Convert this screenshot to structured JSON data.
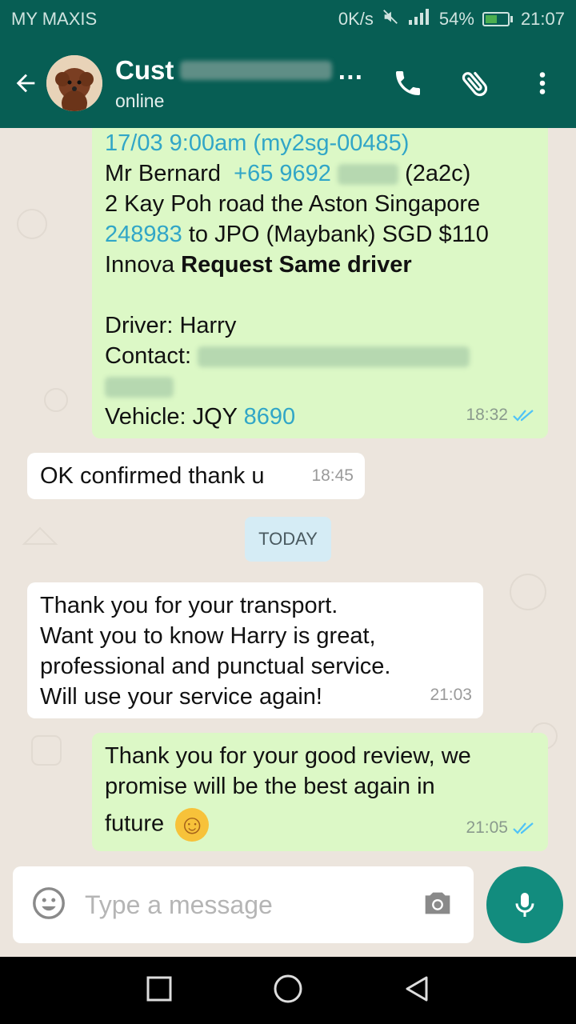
{
  "status_bar": {
    "carrier": "MY MAXIS",
    "speed": "0K/s",
    "battery": "54%",
    "time": "21:07"
  },
  "header": {
    "contact_name": "Cust",
    "status": "online",
    "icons": [
      "back-arrow-icon",
      "phone-icon",
      "attach-icon",
      "more-vert-icon"
    ]
  },
  "messages": [
    {
      "direction": "out",
      "lines": [
        "17/03  9:00am  (my2sg-00485)",
        "Mr Bernard  +65 9692",
        "(2a2c)",
        "2 Kay Poh road the Aston Singapore",
        "248983",
        " to JPO (Maybank)  SGD $110",
        "Innova  ",
        "Request Same driver",
        "Driver: Harry",
        "Contact: ",
        "Vehicle: JQY ",
        "8690"
      ],
      "time": "18:32"
    },
    {
      "direction": "in",
      "text": "OK confirmed thank u",
      "time": "18:45"
    },
    {
      "direction": "in",
      "lines": [
        "Thank you for your transport.",
        "Want you to know Harry is great,",
        "professional and punctual service.",
        "Will use your service again!"
      ],
      "time": "21:03"
    },
    {
      "direction": "out",
      "lines": [
        "Thank you for your good review, we",
        "promise will be the best again in",
        "future"
      ],
      "emoji": "☺",
      "time": "21:05"
    }
  ],
  "day_divider": "TODAY",
  "composer": {
    "placeholder": "Type a message"
  },
  "colors": {
    "header": "#075e54",
    "outgoing": "#dcf8c6",
    "incoming": "#ffffff",
    "wallpaper": "#ece5dd",
    "fab": "#128c7e",
    "tick": "#4fc3f7"
  }
}
